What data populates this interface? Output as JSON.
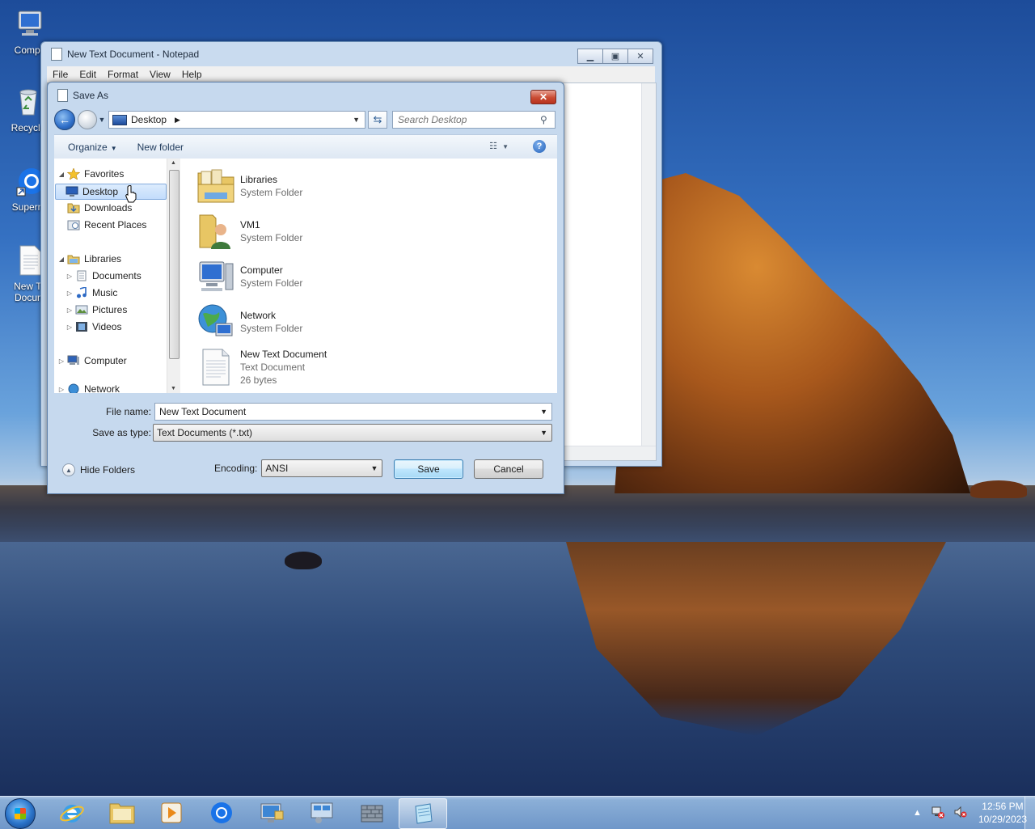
{
  "desktop": {
    "icons": [
      {
        "label": "Compu"
      },
      {
        "label": "Recycle"
      },
      {
        "label": "Supermi"
      },
      {
        "label_line1": "New Te",
        "label_line2": "Docum"
      }
    ]
  },
  "notepad": {
    "title": "New Text Document - Notepad",
    "menu": [
      "File",
      "Edit",
      "Format",
      "View",
      "Help"
    ]
  },
  "dialog": {
    "title": "Save As",
    "address": "Desktop",
    "search_placeholder": "Search Desktop",
    "toolbar": {
      "organize": "Organize",
      "new_folder": "New folder"
    },
    "nav_tree": {
      "favorites": "Favorites",
      "desktop": "Desktop",
      "downloads": "Downloads",
      "recent": "Recent Places",
      "libraries": "Libraries",
      "documents": "Documents",
      "music": "Music",
      "pictures": "Pictures",
      "videos": "Videos",
      "computer": "Computer",
      "network": "Network"
    },
    "files": [
      {
        "name": "Libraries",
        "type": "System Folder"
      },
      {
        "name": "VM1",
        "type": "System Folder"
      },
      {
        "name": "Computer",
        "type": "System Folder"
      },
      {
        "name": "Network",
        "type": "System Folder"
      },
      {
        "name": "New Text Document",
        "type": "Text Document",
        "size": "26 bytes"
      }
    ],
    "file_name_label": "File name:",
    "file_name_value": "New Text Document",
    "save_type_label": "Save as type:",
    "save_type_value": "Text Documents (*.txt)",
    "hide_folders": "Hide Folders",
    "encoding_label": "Encoding:",
    "encoding_value": "ANSI",
    "save_button": "Save",
    "cancel_button": "Cancel"
  },
  "taskbar": {
    "clock_time": "12:56 PM",
    "clock_date": "10/29/2023"
  }
}
